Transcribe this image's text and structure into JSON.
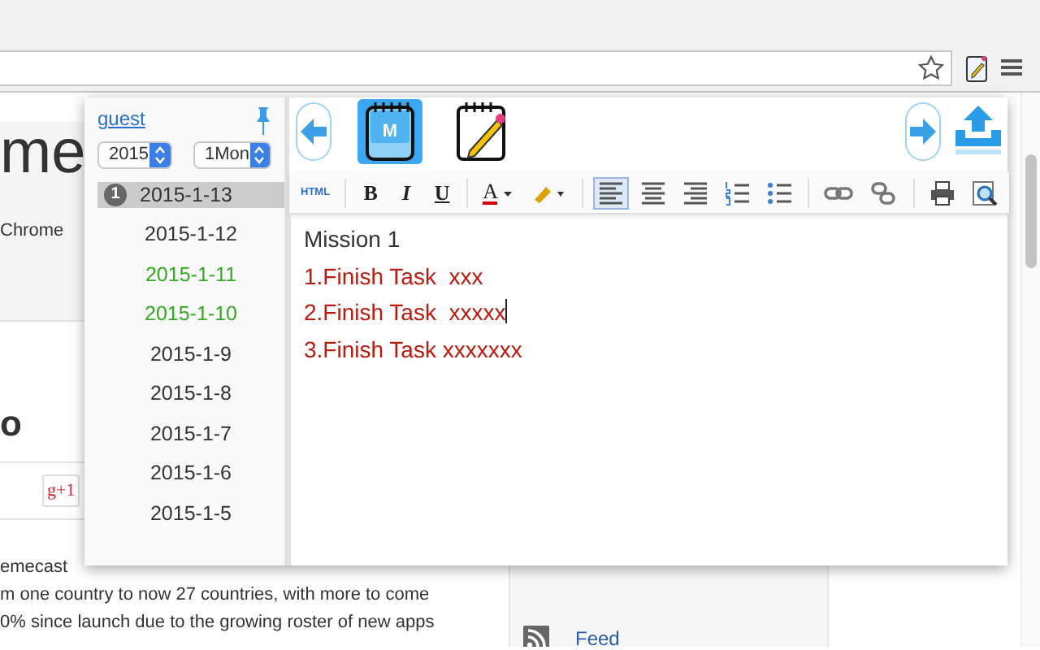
{
  "page": {
    "heading": "me",
    "subtext": "Chrome",
    "title": "o",
    "plus_button": "g+1",
    "paragraph": [
      "emecast",
      "m one country to now 27 countries, with more to come",
      "0% since launch due to the growing roster of new apps"
    ],
    "sidebar_links": [
      "Feed"
    ]
  },
  "popup": {
    "user": "guest",
    "year": "2015",
    "month": "1Mon",
    "dates": [
      {
        "label": "2015-1-13",
        "selected": true,
        "badge": "1",
        "color": "#333333"
      },
      {
        "label": "2015-1-12",
        "selected": false,
        "color": "#333333"
      },
      {
        "label": "2015-1-11",
        "selected": false,
        "color": "#33aa22"
      },
      {
        "label": "2015-1-10",
        "selected": false,
        "color": "#33aa22"
      },
      {
        "label": "2015-1-9",
        "selected": false,
        "color": "#333333"
      },
      {
        "label": "2015-1-8",
        "selected": false,
        "color": "#333333"
      },
      {
        "label": "2015-1-7",
        "selected": false,
        "color": "#333333"
      },
      {
        "label": "2015-1-6",
        "selected": false,
        "color": "#333333"
      },
      {
        "label": "2015-1-5",
        "selected": false,
        "color": "#333333"
      }
    ],
    "notebooks": [
      {
        "kind": "memo",
        "label": "M",
        "selected": true
      },
      {
        "kind": "pencil",
        "selected": false
      }
    ],
    "toolbar": [
      {
        "kind": "html",
        "label": "HTML",
        "active": false
      },
      {
        "kind": "bold",
        "label": "B",
        "active": false
      },
      {
        "kind": "italic",
        "label": "I",
        "active": false
      },
      {
        "kind": "underline",
        "label": "U",
        "active": false
      },
      {
        "kind": "font-color",
        "label": "A",
        "active": false
      },
      {
        "kind": "highlight",
        "active": false
      },
      {
        "kind": "align-left",
        "active": true
      },
      {
        "kind": "align-center",
        "active": false
      },
      {
        "kind": "align-right",
        "active": false
      },
      {
        "kind": "ordered-list",
        "active": false
      },
      {
        "kind": "bullet-list",
        "active": false
      },
      {
        "kind": "link",
        "active": false
      },
      {
        "kind": "unlink",
        "active": false
      },
      {
        "kind": "print",
        "active": false
      },
      {
        "kind": "preview",
        "active": false
      }
    ],
    "lines": [
      {
        "text": "Mission 1",
        "color": "#333333",
        "caret": false
      },
      {
        "text": "1.Finish Task  xxx",
        "color": "#bb1a0e",
        "caret": false
      },
      {
        "text": "2.Finish Task  xxxxx",
        "color": "#bb1a0e",
        "caret": true
      },
      {
        "text": "3.Finish Task xxxxxxx",
        "color": "#bb1a0e",
        "caret": false
      }
    ]
  }
}
